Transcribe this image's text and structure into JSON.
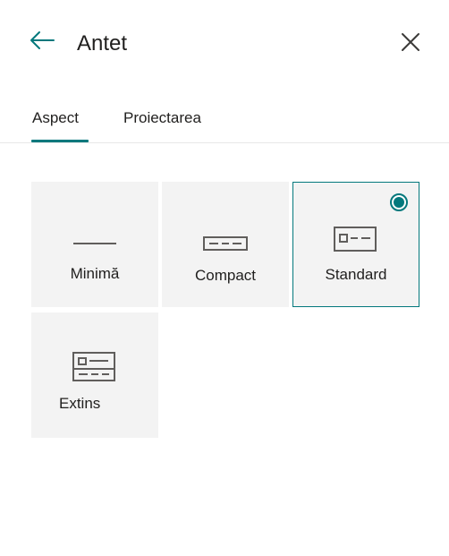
{
  "header": {
    "title": "Antet",
    "back_icon": "arrow-left-icon",
    "close_icon": "close-icon"
  },
  "tabs": [
    {
      "label": "Aspect",
      "selected": true
    },
    {
      "label": "Proiectarea",
      "selected": false
    }
  ],
  "layouts": [
    {
      "label": "Minimă",
      "icon": "layout-minimal-icon",
      "selected": false
    },
    {
      "label": "Compact",
      "icon": "layout-compact-icon",
      "selected": false
    },
    {
      "label": "Standard",
      "icon": "layout-standard-icon",
      "selected": true
    },
    {
      "label": "Extins",
      "icon": "layout-extended-icon",
      "selected": false
    }
  ],
  "colors": {
    "accent": "#03787c",
    "tile_background": "#f3f3f3",
    "text": "#201f1e",
    "icon": "#605e5c"
  }
}
